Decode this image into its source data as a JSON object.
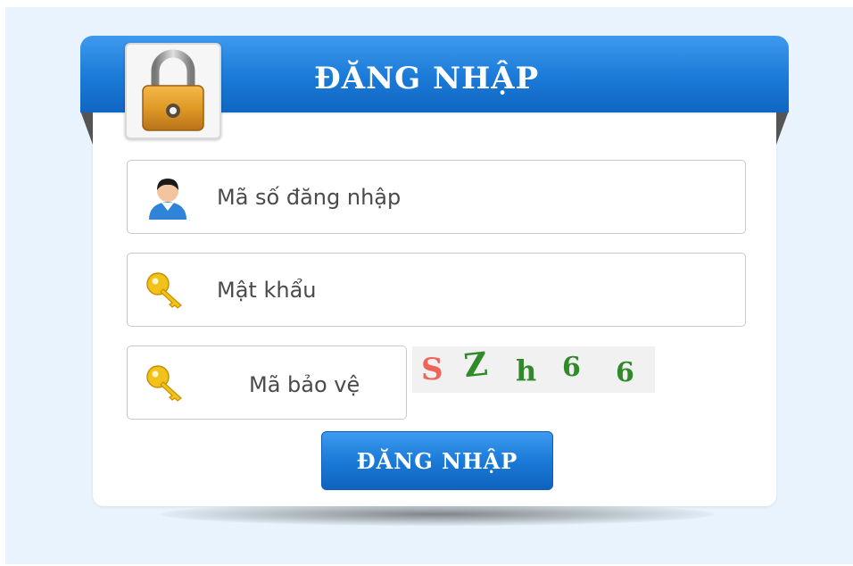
{
  "header": {
    "title": "ĐĂNG NHẬP",
    "icon": "padlock-icon"
  },
  "form": {
    "username": {
      "placeholder": "Mã số đăng nhập",
      "value": "",
      "icon": "user-icon"
    },
    "password": {
      "placeholder": "Mật khẩu",
      "value": "",
      "icon": "key-icon"
    },
    "captcha_input": {
      "placeholder": "Mã bảo vệ",
      "value": "",
      "icon": "key-icon"
    },
    "captcha_image": {
      "chars": [
        {
          "text": "S",
          "color": "#f0645a"
        },
        {
          "text": "Z",
          "color": "#2f8a2a"
        },
        {
          "text": "h",
          "color": "#2f8a2a"
        },
        {
          "text": "6",
          "color": "#2f8a2a"
        },
        {
          "text": "6",
          "color": "#2f8a2a"
        }
      ]
    },
    "submit_label": "ĐĂNG NHẬP"
  },
  "colors": {
    "accent": "#1a7ad7",
    "background": "#e8f3fd"
  }
}
